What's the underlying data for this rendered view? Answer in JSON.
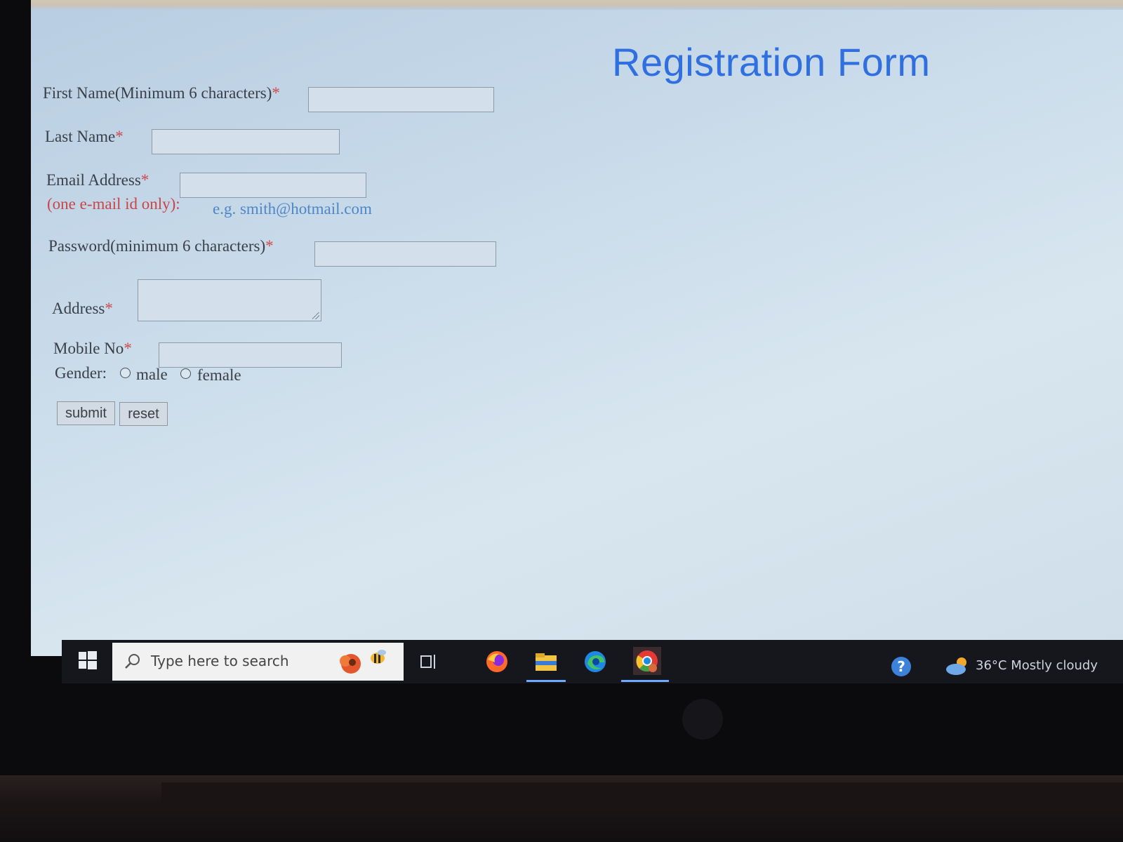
{
  "title": "Registration Form",
  "fields": {
    "first_name": {
      "label": "First Name(Minimum 6 characters)",
      "required_mark": "*",
      "value": ""
    },
    "last_name": {
      "label": "Last Name",
      "required_mark": "*",
      "value": ""
    },
    "email": {
      "label": "Email Address",
      "required_mark": "*",
      "note": "(one e-mail id only):",
      "example": "e.g. smith@hotmail.com",
      "value": ""
    },
    "password": {
      "label": "Password(minimum 6 characters)",
      "required_mark": "*",
      "value": ""
    },
    "address": {
      "label": "Address",
      "required_mark": "*",
      "value": ""
    },
    "mobile": {
      "label": "Mobile No",
      "required_mark": "*",
      "value": ""
    }
  },
  "gender": {
    "label": "Gender:",
    "options": [
      {
        "label": "male",
        "selected": false
      },
      {
        "label": "female",
        "selected": false
      }
    ]
  },
  "buttons": {
    "submit": "submit",
    "reset": "reset"
  },
  "taskbar": {
    "search_placeholder": "Type here to search",
    "weather": {
      "temperature": "36°C",
      "condition": "Mostly cloudy"
    },
    "icons": [
      "windows-start-icon",
      "search-icon",
      "flower-bee-icon",
      "task-view-icon",
      "firefox-icon",
      "file-explorer-icon",
      "edge-icon",
      "chrome-icon",
      "help-icon",
      "cloud-weather-icon"
    ]
  },
  "colors": {
    "title": "#2f6fe0",
    "required": "#d04848",
    "hint_red": "#c84646",
    "hint_blue": "#4f86c6",
    "page_background": "#c9dbea",
    "taskbar": "#16171c"
  }
}
